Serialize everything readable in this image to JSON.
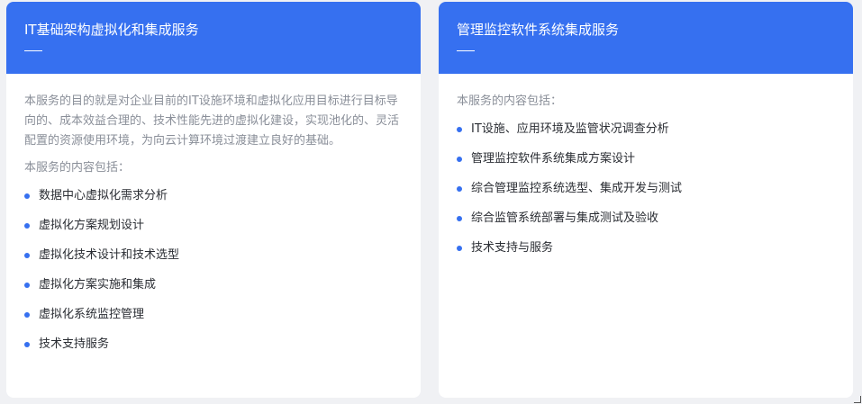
{
  "cards": [
    {
      "title": "IT基础架构虚拟化和集成服务",
      "description": "本服务的目的就是对企业目前的IT设施环境和虚拟化应用目标进行目标导向的、成本效益合理的、技术性能先进的虚拟化建设，实现池化的、灵活配置的资源使用环境，为向云计算环境过渡建立良好的基础。",
      "intro": "本服务的内容包括：",
      "items": [
        "数据中心虚拟化需求分析",
        "虚拟化方案规划设计",
        "虚拟化技术设计和技术选型",
        "虚拟化方案实施和集成",
        "虚拟化系统监控管理",
        "技术支持服务"
      ]
    },
    {
      "title": "管理监控软件系统集成服务",
      "intro": "本服务的内容包括：",
      "items": [
        "IT设施、应用环境及监管状况调查分析",
        "管理监控软件系统集成方案设计",
        "综合管理监控系统选型、集成开发与测试",
        "综合监管系统部署与集成测试及验收",
        "技术支持与服务"
      ]
    }
  ],
  "colors": {
    "header": "#3670f0",
    "bullet": "#3670f0",
    "background": "#f0f1f4"
  }
}
